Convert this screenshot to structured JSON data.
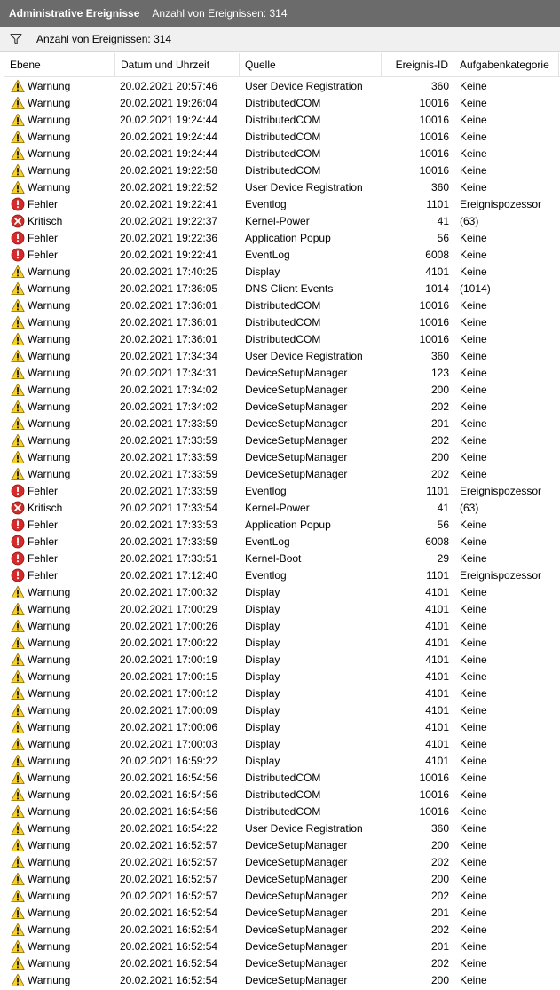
{
  "title": "Administrative Ereignisse",
  "title_count": "Anzahl von Ereignissen: 314",
  "filter_text": "Anzahl von Ereignissen: 314",
  "columns": {
    "level": "Ebene",
    "datetime": "Datum und Uhrzeit",
    "source": "Quelle",
    "event_id": "Ereignis-ID",
    "task_category": "Aufgabenkategorie"
  },
  "level_icons": {
    "Warnung": "warning-icon",
    "Fehler": "error-icon",
    "Kritisch": "critical-icon"
  },
  "colors": {
    "titlebar_bg": "#6b6b6b",
    "warning_yellow": "#f8d030",
    "error_red": "#d62b2b",
    "critical_red": "#c9302c"
  },
  "rows": [
    [
      "Warnung",
      "20.02.2021 20:57:46",
      "User Device Registration",
      "360",
      "Keine"
    ],
    [
      "Warnung",
      "20.02.2021 19:26:04",
      "DistributedCOM",
      "10016",
      "Keine"
    ],
    [
      "Warnung",
      "20.02.2021 19:24:44",
      "DistributedCOM",
      "10016",
      "Keine"
    ],
    [
      "Warnung",
      "20.02.2021 19:24:44",
      "DistributedCOM",
      "10016",
      "Keine"
    ],
    [
      "Warnung",
      "20.02.2021 19:24:44",
      "DistributedCOM",
      "10016",
      "Keine"
    ],
    [
      "Warnung",
      "20.02.2021 19:22:58",
      "DistributedCOM",
      "10016",
      "Keine"
    ],
    [
      "Warnung",
      "20.02.2021 19:22:52",
      "User Device Registration",
      "360",
      "Keine"
    ],
    [
      "Fehler",
      "20.02.2021 19:22:41",
      "Eventlog",
      "1101",
      "Ereignispozessor"
    ],
    [
      "Kritisch",
      "20.02.2021 19:22:37",
      "Kernel-Power",
      "41",
      "(63)"
    ],
    [
      "Fehler",
      "20.02.2021 19:22:36",
      "Application Popup",
      "56",
      "Keine"
    ],
    [
      "Fehler",
      "20.02.2021 19:22:41",
      "EventLog",
      "6008",
      "Keine"
    ],
    [
      "Warnung",
      "20.02.2021 17:40:25",
      "Display",
      "4101",
      "Keine"
    ],
    [
      "Warnung",
      "20.02.2021 17:36:05",
      "DNS Client Events",
      "1014",
      "(1014)"
    ],
    [
      "Warnung",
      "20.02.2021 17:36:01",
      "DistributedCOM",
      "10016",
      "Keine"
    ],
    [
      "Warnung",
      "20.02.2021 17:36:01",
      "DistributedCOM",
      "10016",
      "Keine"
    ],
    [
      "Warnung",
      "20.02.2021 17:36:01",
      "DistributedCOM",
      "10016",
      "Keine"
    ],
    [
      "Warnung",
      "20.02.2021 17:34:34",
      "User Device Registration",
      "360",
      "Keine"
    ],
    [
      "Warnung",
      "20.02.2021 17:34:31",
      "DeviceSetupManager",
      "123",
      "Keine"
    ],
    [
      "Warnung",
      "20.02.2021 17:34:02",
      "DeviceSetupManager",
      "200",
      "Keine"
    ],
    [
      "Warnung",
      "20.02.2021 17:34:02",
      "DeviceSetupManager",
      "202",
      "Keine"
    ],
    [
      "Warnung",
      "20.02.2021 17:33:59",
      "DeviceSetupManager",
      "201",
      "Keine"
    ],
    [
      "Warnung",
      "20.02.2021 17:33:59",
      "DeviceSetupManager",
      "202",
      "Keine"
    ],
    [
      "Warnung",
      "20.02.2021 17:33:59",
      "DeviceSetupManager",
      "200",
      "Keine"
    ],
    [
      "Warnung",
      "20.02.2021 17:33:59",
      "DeviceSetupManager",
      "202",
      "Keine"
    ],
    [
      "Fehler",
      "20.02.2021 17:33:59",
      "Eventlog",
      "1101",
      "Ereignispozessor"
    ],
    [
      "Kritisch",
      "20.02.2021 17:33:54",
      "Kernel-Power",
      "41",
      "(63)"
    ],
    [
      "Fehler",
      "20.02.2021 17:33:53",
      "Application Popup",
      "56",
      "Keine"
    ],
    [
      "Fehler",
      "20.02.2021 17:33:59",
      "EventLog",
      "6008",
      "Keine"
    ],
    [
      "Fehler",
      "20.02.2021 17:33:51",
      "Kernel-Boot",
      "29",
      "Keine"
    ],
    [
      "Fehler",
      "20.02.2021 17:12:40",
      "Eventlog",
      "1101",
      "Ereignispozessor"
    ],
    [
      "Warnung",
      "20.02.2021 17:00:32",
      "Display",
      "4101",
      "Keine"
    ],
    [
      "Warnung",
      "20.02.2021 17:00:29",
      "Display",
      "4101",
      "Keine"
    ],
    [
      "Warnung",
      "20.02.2021 17:00:26",
      "Display",
      "4101",
      "Keine"
    ],
    [
      "Warnung",
      "20.02.2021 17:00:22",
      "Display",
      "4101",
      "Keine"
    ],
    [
      "Warnung",
      "20.02.2021 17:00:19",
      "Display",
      "4101",
      "Keine"
    ],
    [
      "Warnung",
      "20.02.2021 17:00:15",
      "Display",
      "4101",
      "Keine"
    ],
    [
      "Warnung",
      "20.02.2021 17:00:12",
      "Display",
      "4101",
      "Keine"
    ],
    [
      "Warnung",
      "20.02.2021 17:00:09",
      "Display",
      "4101",
      "Keine"
    ],
    [
      "Warnung",
      "20.02.2021 17:00:06",
      "Display",
      "4101",
      "Keine"
    ],
    [
      "Warnung",
      "20.02.2021 17:00:03",
      "Display",
      "4101",
      "Keine"
    ],
    [
      "Warnung",
      "20.02.2021 16:59:22",
      "Display",
      "4101",
      "Keine"
    ],
    [
      "Warnung",
      "20.02.2021 16:54:56",
      "DistributedCOM",
      "10016",
      "Keine"
    ],
    [
      "Warnung",
      "20.02.2021 16:54:56",
      "DistributedCOM",
      "10016",
      "Keine"
    ],
    [
      "Warnung",
      "20.02.2021 16:54:56",
      "DistributedCOM",
      "10016",
      "Keine"
    ],
    [
      "Warnung",
      "20.02.2021 16:54:22",
      "User Device Registration",
      "360",
      "Keine"
    ],
    [
      "Warnung",
      "20.02.2021 16:52:57",
      "DeviceSetupManager",
      "200",
      "Keine"
    ],
    [
      "Warnung",
      "20.02.2021 16:52:57",
      "DeviceSetupManager",
      "202",
      "Keine"
    ],
    [
      "Warnung",
      "20.02.2021 16:52:57",
      "DeviceSetupManager",
      "200",
      "Keine"
    ],
    [
      "Warnung",
      "20.02.2021 16:52:57",
      "DeviceSetupManager",
      "202",
      "Keine"
    ],
    [
      "Warnung",
      "20.02.2021 16:52:54",
      "DeviceSetupManager",
      "201",
      "Keine"
    ],
    [
      "Warnung",
      "20.02.2021 16:52:54",
      "DeviceSetupManager",
      "202",
      "Keine"
    ],
    [
      "Warnung",
      "20.02.2021 16:52:54",
      "DeviceSetupManager",
      "201",
      "Keine"
    ],
    [
      "Warnung",
      "20.02.2021 16:52:54",
      "DeviceSetupManager",
      "202",
      "Keine"
    ],
    [
      "Warnung",
      "20.02.2021 16:52:54",
      "DeviceSetupManager",
      "200",
      "Keine"
    ]
  ]
}
